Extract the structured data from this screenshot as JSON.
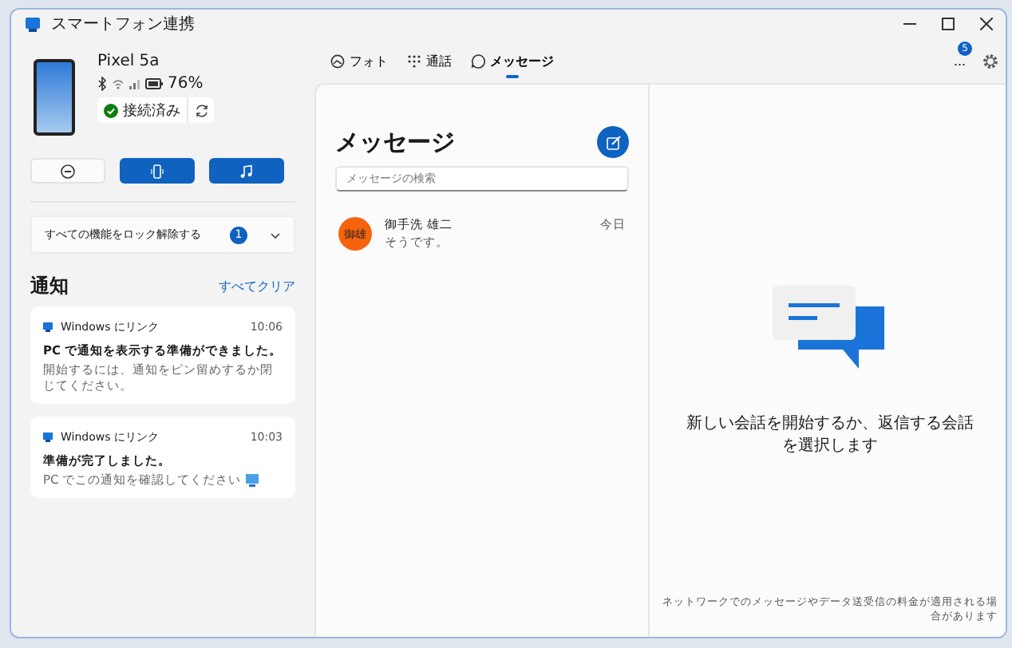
{
  "window": {
    "title": "スマートフォン連携"
  },
  "device": {
    "name": "Pixel 5a",
    "battery": "76%",
    "status": "接続済み",
    "connected": true
  },
  "quick_actions": [
    {
      "kind": "dnd",
      "on": false
    },
    {
      "kind": "phone",
      "on": true
    },
    {
      "kind": "music",
      "on": true
    }
  ],
  "unlock": {
    "label": "すべての機能をロック解除する",
    "count": "1",
    "expanded": false
  },
  "notifications": {
    "title": "通知",
    "clear_all": "すべてクリア",
    "items": [
      {
        "app": "Windows にリンク",
        "time": "10:06",
        "title": "PC で通知を表示する準備ができました。",
        "body": "開始するには、通知をピン留めするか閉じてください。"
      },
      {
        "app": "Windows にリンク",
        "time": "10:03",
        "title": "準備が完了しました。",
        "body": "PC でこの通知を確認してください"
      }
    ]
  },
  "tabs": [
    {
      "label": "フォト",
      "kind": "photos",
      "selected": false
    },
    {
      "label": "通話",
      "kind": "calls",
      "selected": false
    },
    {
      "label": "メッセージ",
      "kind": "messages",
      "selected": true
    }
  ],
  "toolbar": {
    "more": "...",
    "badge": "5"
  },
  "messages": {
    "title": "メッセージ",
    "search": {
      "placeholder": "メッセージの検索"
    },
    "conversations": [
      {
        "avatar": "御雄",
        "color": "#f7630c",
        "name": "御手洗 雄二",
        "preview": "そうです。",
        "time": "今日",
        "selected": false
      }
    ]
  },
  "empty_state": {
    "text": "新しい会話を開始するか、返信する会話を選択します"
  },
  "footer": "ネットワークでのメッセージやデータ送受信の料金が適用される場合があります"
}
